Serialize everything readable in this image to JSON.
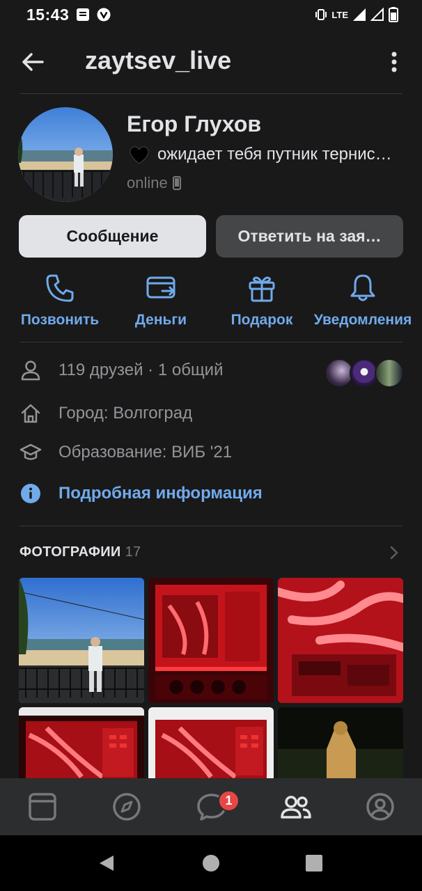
{
  "status_bar": {
    "time": "15:43",
    "network": "LTE"
  },
  "header": {
    "title": "zaytsev_live"
  },
  "profile": {
    "name": "Егор Глухов",
    "status": "ожидает тебя путник тернис…",
    "online": "online"
  },
  "actions": {
    "message_label": "Сообщение",
    "reply_request_label": "Ответить на зая…"
  },
  "quick_actions": [
    {
      "label": "Позвонить",
      "icon": "phone-icon"
    },
    {
      "label": "Деньги",
      "icon": "money-transfer-icon"
    },
    {
      "label": "Подарок",
      "icon": "gift-icon"
    },
    {
      "label": "Уведомления",
      "icon": "bell-icon"
    }
  ],
  "info": {
    "friends": "119 друзей · 1 общий",
    "city": "Город: Волгоград",
    "education": "Образование: ВИБ '21",
    "details_link": "Подробная информация"
  },
  "photos": {
    "title": "ФОТОГРАФИИ",
    "count": "17"
  },
  "tabbar": {
    "items": [
      "feed-icon",
      "discover-icon",
      "messages-icon",
      "friends-icon",
      "profile-icon"
    ],
    "active": "friends-icon",
    "messages_badge": "1"
  },
  "colors": {
    "background": "#19191a",
    "accent": "#71aaeb",
    "secondary_text": "#939598",
    "badge": "#e64646"
  }
}
